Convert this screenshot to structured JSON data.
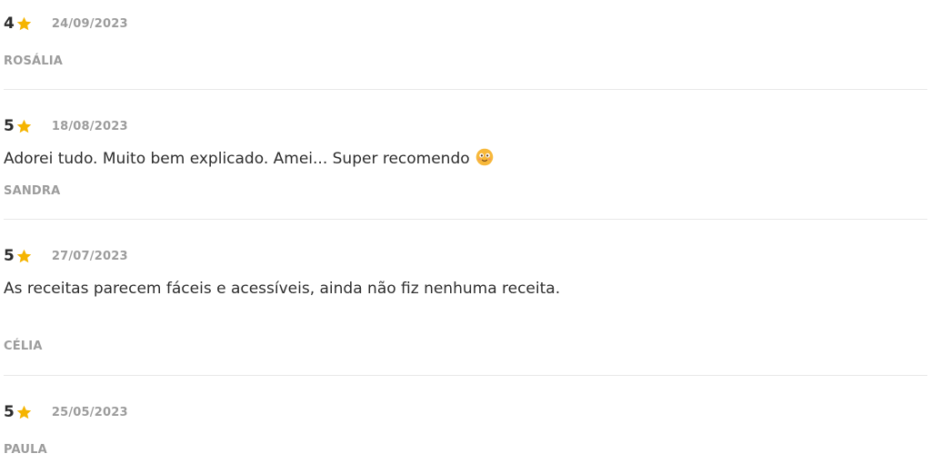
{
  "reviews": [
    {
      "score": "4",
      "star_icon": "star-icon",
      "date": "24/09/2023",
      "text": "",
      "author": "ROSÁLIA"
    },
    {
      "score": "5",
      "star_icon": "star-icon",
      "date": "18/08/2023",
      "text": "Adorei tudo. Muito bem explicado. Amei... Super recomendo",
      "emoji_icon": "smiling-face-emoji-icon",
      "author": "SANDRA"
    },
    {
      "score": "5",
      "star_icon": "star-icon",
      "date": "27/07/2023",
      "text": "As receitas parecem fáceis e acessíveis, ainda não fiz nenhuma receita.",
      "author": "CÉLIA"
    },
    {
      "score": "5",
      "star_icon": "star-icon",
      "date": "25/05/2023",
      "text": "",
      "author": "PAULA"
    }
  ],
  "colors": {
    "star": "#f5b400",
    "score_text": "#2b2b2b",
    "meta_text": "#9c9c9c",
    "body_text": "#2d2d2d",
    "divider": "#e8e8e8"
  }
}
